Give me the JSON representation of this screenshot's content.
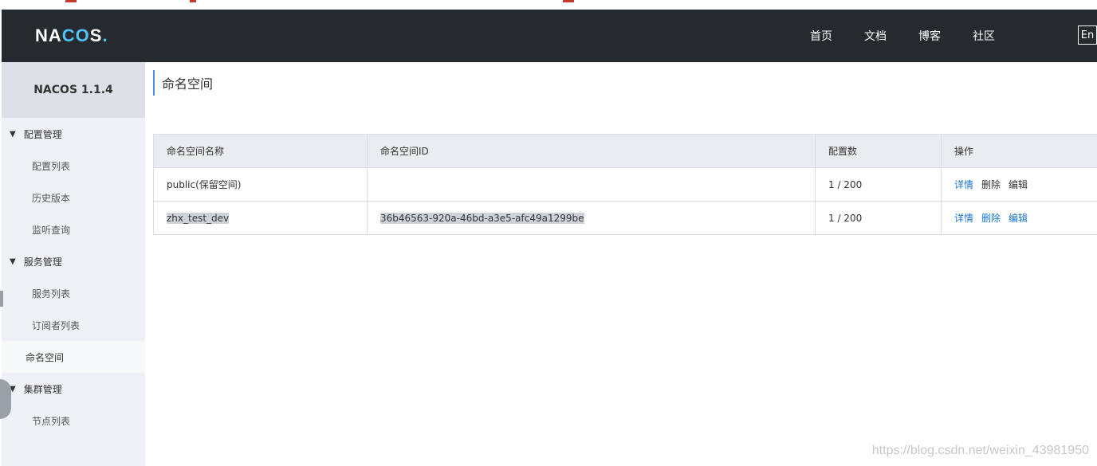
{
  "header": {
    "logo_text_pre": "NA",
    "logo_text_co": "CO",
    "logo_text_post": "S",
    "logo_dot": ".",
    "nav": [
      "首页",
      "文档",
      "博客",
      "社区"
    ],
    "lang": "En"
  },
  "sidebar": {
    "version": "NACOS 1.1.4",
    "groups": {
      "config": {
        "label": "配置管理",
        "items": [
          "配置列表",
          "历史版本",
          "监听查询"
        ]
      },
      "service": {
        "label": "服务管理",
        "items": [
          "服务列表",
          "订阅者列表"
        ]
      },
      "namespace": {
        "label": "命名空间"
      },
      "cluster": {
        "label": "集群管理",
        "items": [
          "节点列表"
        ]
      }
    }
  },
  "main": {
    "title": "命名空间",
    "table": {
      "headers": [
        "命名空间名称",
        "命名空间ID",
        "配置数",
        "操作"
      ],
      "rows": [
        {
          "name": "public(保留空间)",
          "id": "",
          "count": "1 / 200",
          "ops": [
            "详情",
            "删除",
            "编辑"
          ]
        },
        {
          "name": "zhx_test_dev",
          "id": "36b46563-920a-46bd-a3e5-afc49a1299be",
          "count": "1 / 200",
          "ops": [
            "详情",
            "删除",
            "编辑"
          ]
        }
      ]
    }
  },
  "watermark": "https://blog.csdn.net/weixin_43981950",
  "colors": {
    "header_bg": "#252a2f",
    "sidebar_bg": "#eef1f6",
    "link": "#1976d2",
    "accent": "#4a90e2"
  }
}
